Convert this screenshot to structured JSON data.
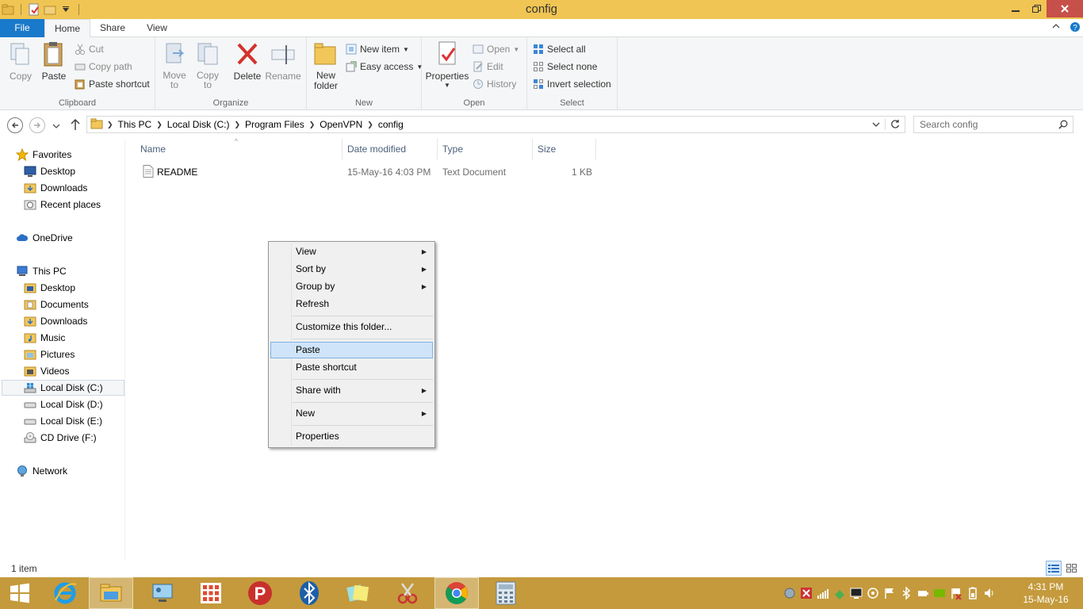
{
  "window": {
    "title": "config"
  },
  "ribbon_tabs": {
    "file": "File",
    "home": "Home",
    "share": "Share",
    "view": "View"
  },
  "ribbon": {
    "clipboard": {
      "label": "Clipboard",
      "copy": "Copy",
      "paste": "Paste",
      "cut": "Cut",
      "copy_path": "Copy path",
      "paste_shortcut": "Paste shortcut"
    },
    "organize": {
      "label": "Organize",
      "move_to_1": "Move",
      "move_to_2": "to",
      "copy_to_1": "Copy",
      "copy_to_2": "to",
      "delete": "Delete",
      "rename": "Rename"
    },
    "new": {
      "label": "New",
      "new_folder_1": "New",
      "new_folder_2": "folder",
      "new_item": "New item",
      "easy_access": "Easy access"
    },
    "open": {
      "label": "Open",
      "properties": "Properties",
      "open": "Open",
      "edit": "Edit",
      "history": "History"
    },
    "select": {
      "label": "Select",
      "select_all": "Select all",
      "select_none": "Select none",
      "invert_selection": "Invert selection"
    }
  },
  "address": {
    "crumbs": [
      "This PC",
      "Local Disk (C:)",
      "Program Files",
      "OpenVPN",
      "config"
    ],
    "search_placeholder": "Search config"
  },
  "nav_pane": {
    "favorites": "Favorites",
    "fav_items": [
      "Desktop",
      "Downloads",
      "Recent places"
    ],
    "onedrive": "OneDrive",
    "this_pc": "This PC",
    "pc_items": [
      "Desktop",
      "Documents",
      "Downloads",
      "Music",
      "Pictures",
      "Videos",
      "Local Disk (C:)",
      "Local Disk (D:)",
      "Local Disk (E:)",
      "CD Drive (F:)"
    ],
    "network": "Network"
  },
  "file_list": {
    "columns": {
      "name": "Name",
      "date": "Date modified",
      "type": "Type",
      "size": "Size"
    },
    "rows": [
      {
        "name": "README",
        "date": "15-May-16 4:03 PM",
        "type": "Text Document",
        "size": "1 KB"
      }
    ]
  },
  "context_menu": {
    "view": "View",
    "sort_by": "Sort by",
    "group_by": "Group by",
    "refresh": "Refresh",
    "customize": "Customize this folder...",
    "paste": "Paste",
    "paste_shortcut": "Paste shortcut",
    "share_with": "Share with",
    "new": "New",
    "properties": "Properties"
  },
  "status_bar": {
    "item_count": "1 item"
  },
  "taskbar": {
    "time": "4:31 PM",
    "date": "15-May-16"
  },
  "colors": {
    "titlebar": "#f0c553",
    "file_tab": "#1979ca",
    "taskbar": "#c49a3c",
    "highlight": "#cfe4f8",
    "close": "#c7504a"
  }
}
